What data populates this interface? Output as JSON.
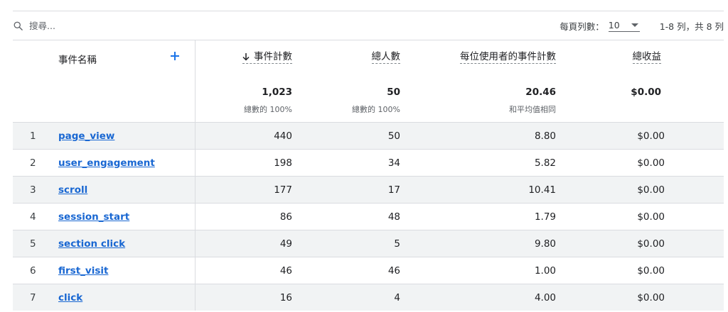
{
  "search": {
    "placeholder": "搜尋..."
  },
  "pagination": {
    "rows_per_page_label": "每頁列數：",
    "rows_per_page_value": "10",
    "range_text": "1-8 列，共 8 列"
  },
  "columns": {
    "event_name": "事件名稱",
    "event_count": "事件計數",
    "total_users": "總人數",
    "per_user": "每位使用者的事件計數",
    "revenue": "總收益"
  },
  "totals": {
    "event_count": "1,023",
    "event_count_sub": "總數的 100%",
    "total_users": "50",
    "total_users_sub": "總數的 100%",
    "per_user": "20.46",
    "per_user_sub": "和平均值相同",
    "revenue": "$0.00"
  },
  "rows": [
    {
      "idx": "1",
      "name": "page_view",
      "count": "440",
      "users": "50",
      "per": "8.80",
      "rev": "$0.00"
    },
    {
      "idx": "2",
      "name": "user_engagement",
      "count": "198",
      "users": "34",
      "per": "5.82",
      "rev": "$0.00"
    },
    {
      "idx": "3",
      "name": "scroll",
      "count": "177",
      "users": "17",
      "per": "10.41",
      "rev": "$0.00"
    },
    {
      "idx": "4",
      "name": "session_start",
      "count": "86",
      "users": "48",
      "per": "1.79",
      "rev": "$0.00"
    },
    {
      "idx": "5",
      "name": "section click",
      "count": "49",
      "users": "5",
      "per": "9.80",
      "rev": "$0.00"
    },
    {
      "idx": "6",
      "name": "first_visit",
      "count": "46",
      "users": "46",
      "per": "1.00",
      "rev": "$0.00"
    },
    {
      "idx": "7",
      "name": "click",
      "count": "16",
      "users": "4",
      "per": "4.00",
      "rev": "$0.00"
    }
  ],
  "icons": {
    "search": "search-icon",
    "dropdown": "caret-down-icon",
    "add": "plus-icon",
    "sort": "arrow-down-icon"
  },
  "colors": {
    "link": "#1967d2",
    "accent": "#1a73e8",
    "stripe": "#f1f3f4",
    "border": "#dadce0"
  }
}
